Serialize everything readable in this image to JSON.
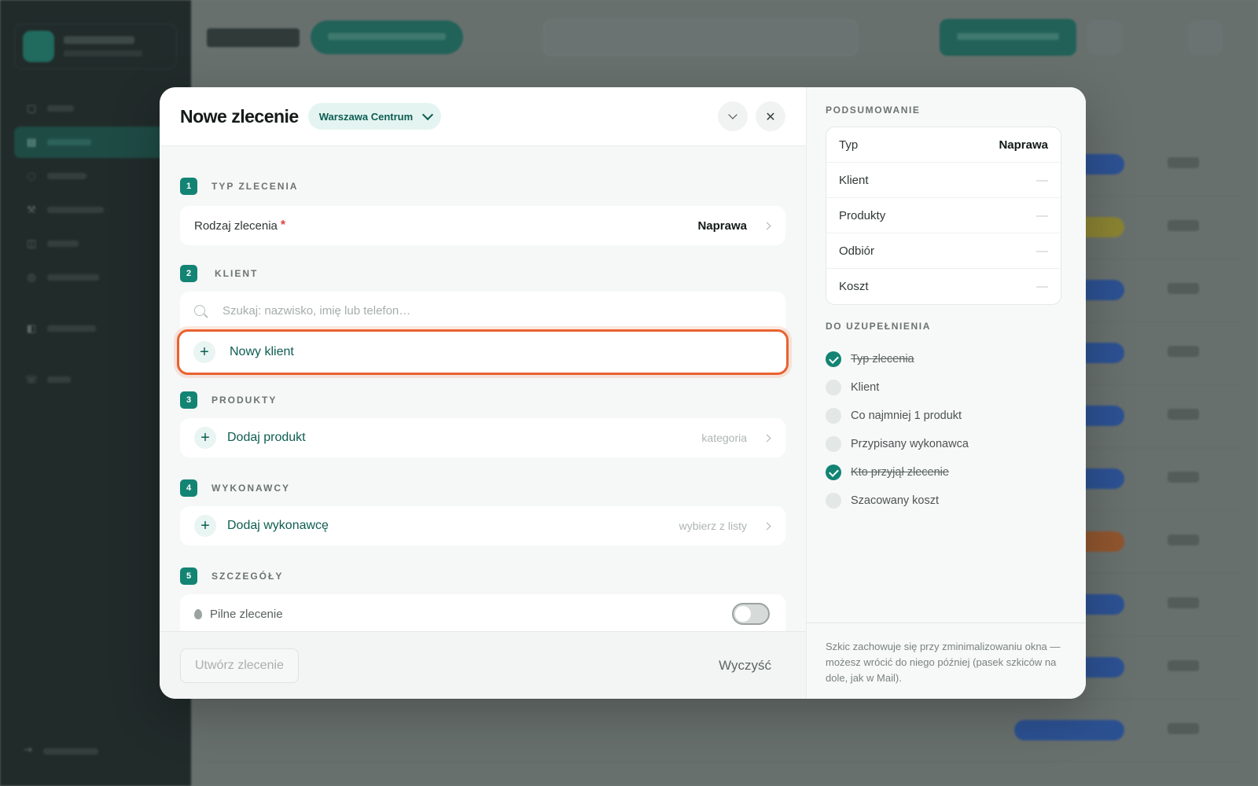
{
  "modal": {
    "title": "Nowe zlecenie",
    "branch": "Warszawa Centrum"
  },
  "sections": {
    "typ": {
      "num": "1",
      "label": "TYP ZLECENIA",
      "field_label": "Rodzaj zlecenia",
      "required_mark": "*",
      "value": "Naprawa"
    },
    "klient": {
      "num": "2",
      "label": "KLIENT",
      "search_placeholder": "Szukaj: nazwisko, imię lub telefon…",
      "new_client_label": "Nowy klient",
      "plus": "+"
    },
    "produkty": {
      "num": "3",
      "label": "PRODUKTY",
      "add_label": "Dodaj produkt",
      "hint": "kategoria",
      "plus": "+"
    },
    "wykonawcy": {
      "num": "4",
      "label": "WYKONAWCY",
      "add_label": "Dodaj wykonawcę",
      "hint": "wybierz z listy",
      "plus": "+"
    },
    "szczegoly": {
      "num": "5",
      "label": "SZCZEGÓŁY",
      "urgent_label": "Pilne zlecenie",
      "urgent_on": false
    }
  },
  "footer": {
    "create_label": "Utwórz zlecenie",
    "clear_label": "Wyczyść"
  },
  "summary": {
    "title": "PODSUMOWANIE",
    "rows": [
      {
        "label": "Typ",
        "value": "Naprawa"
      },
      {
        "label": "Klient",
        "value": "—"
      },
      {
        "label": "Produkty",
        "value": "—"
      },
      {
        "label": "Odbiór",
        "value": "—"
      },
      {
        "label": "Koszt",
        "value": "—"
      }
    ]
  },
  "todo": {
    "title": "DO UZUPEŁNIENIA",
    "items": [
      {
        "label": "Typ zlecenia",
        "done": true
      },
      {
        "label": "Klient",
        "done": false
      },
      {
        "label": "Co najmniej 1 produkt",
        "done": false
      },
      {
        "label": "Przypisany wykonawca",
        "done": false
      },
      {
        "label": "Kto przyjął zlecenie",
        "done": true
      },
      {
        "label": "Szacowany koszt",
        "done": false
      }
    ]
  },
  "draft_note": "Szkic zachowuje się przy zminimalizowaniu okna — możesz wrócić do niego później (pasek szkiców na dole, jak w Mail).",
  "colors": {
    "accent": "#138473",
    "highlight": "#e8622f"
  }
}
